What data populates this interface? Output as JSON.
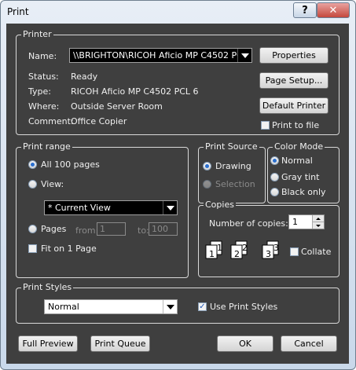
{
  "window": {
    "title": "Print",
    "help": "?",
    "close": "✕"
  },
  "printer": {
    "group_label": "Printer",
    "name_label": "Name:",
    "name_value": "\\\\BRIGHTON\\RICOH Aficio MP C4502 PC",
    "status_label": "Status:",
    "status_value": "Ready",
    "type_label": "Type:",
    "type_value": "RICOH Aficio MP C4502 PCL 6",
    "where_label": "Where:",
    "where_value": "Outside Server Room",
    "comment_label": "Comment:",
    "comment_value": "Office Copier",
    "properties_btn": "Properties",
    "page_setup_btn": "Page Setup...",
    "default_printer_btn": "Default Printer",
    "print_to_file_label": "Print to file",
    "print_to_file_checked": false
  },
  "print_range": {
    "group_label": "Print range",
    "all_label": "All 100 pages",
    "view_label": "View:",
    "view_value": "* Current View",
    "pages_label": "Pages",
    "from_label": "from:",
    "from_value": "1",
    "to_label": "to:",
    "to_value": "100",
    "fit_label": "Fit on 1 Page",
    "selected": "all"
  },
  "print_source": {
    "group_label": "Print Source",
    "drawing_label": "Drawing",
    "selection_label": "Selection",
    "selected": "drawing"
  },
  "color_mode": {
    "group_label": "Color Mode",
    "normal_label": "Normal",
    "gray_label": "Gray tint",
    "black_label": "Black only",
    "selected": "normal"
  },
  "copies": {
    "group_label": "Copies",
    "number_label": "Number of copies:",
    "number_value": "1",
    "collate_label": "Collate",
    "collate_checked": false,
    "page_digits": [
      "1",
      "1",
      "2",
      "2",
      "3",
      "3"
    ]
  },
  "print_styles": {
    "group_label": "Print Styles",
    "style_value": "Normal",
    "use_label": "Use Print Styles",
    "use_checked": true,
    "check_glyph": "✓"
  },
  "footer": {
    "full_preview_btn": "Full Preview",
    "print_queue_btn": "Print Queue",
    "ok_btn": "OK",
    "cancel_btn": "Cancel"
  }
}
